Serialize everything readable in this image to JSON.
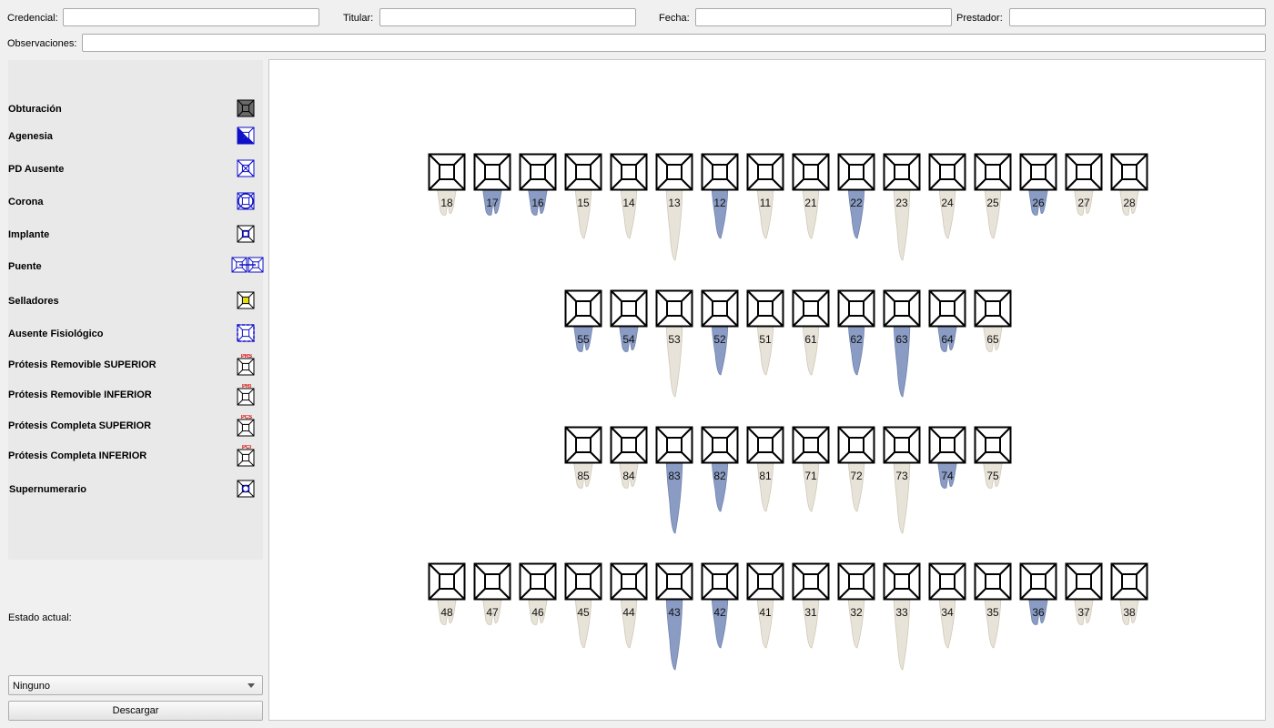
{
  "header": {
    "credencial_label": "Credencial:",
    "credencial_value": "",
    "titular_label": "Titular:",
    "titular_value": "",
    "fecha_label": "Fecha:",
    "fecha_value": "",
    "prestador_label": "Prestador:",
    "prestador_value": "",
    "observaciones_label": "Observaciones:",
    "observaciones_value": ""
  },
  "legend": [
    {
      "label": "Obturación",
      "icon": "obturacion-icon"
    },
    {
      "label": "Agenesia",
      "icon": "agenesia-icon"
    },
    {
      "label": "PD Ausente",
      "icon": "pd-ausente-icon"
    },
    {
      "label": "Corona",
      "icon": "corona-icon"
    },
    {
      "label": "Implante",
      "icon": "implante-icon"
    },
    {
      "label": "Puente",
      "icon": "puente-icon"
    },
    {
      "label": "Selladores",
      "icon": "selladores-icon"
    },
    {
      "label": "Ausente Fisiológico",
      "icon": "ausente-fisiologico-icon"
    },
    {
      "label": "Prótesis Removible SUPERIOR",
      "icon": "protesis-removible-superior-icon",
      "tag": "PRS"
    },
    {
      "label": "Prótesis Removible INFERIOR",
      "icon": "protesis-removible-inferior-icon",
      "tag": "PRI"
    },
    {
      "label": "Prótesis Completa SUPERIOR",
      "icon": "protesis-completa-superior-icon",
      "tag": "PCS"
    },
    {
      "label": "Prótesis Completa INFERIOR",
      "icon": "protesis-completa-inferior-icon",
      "tag": "PCI"
    },
    {
      "label": "Supernumerario",
      "icon": "supernumerario-icon"
    }
  ],
  "estado_actual_label": "Estado actual:",
  "estado_select": {
    "selected": "Ninguno"
  },
  "download_label": "Descargar",
  "colors": {
    "tooth_outline": "#000000",
    "root_ivory": "#e8e3d8",
    "root_blue": "#8a9cc4",
    "legend_blue": "#1010c8"
  },
  "odontogram": {
    "rows": [
      {
        "teeth": [
          "18",
          "17",
          "16",
          "15",
          "14",
          "13",
          "12",
          "11",
          "21",
          "22",
          "23",
          "24",
          "25",
          "26",
          "27",
          "28"
        ],
        "blue": [
          "17",
          "16",
          "12",
          "22",
          "26"
        ]
      },
      {
        "teeth": [
          "55",
          "54",
          "53",
          "52",
          "51",
          "61",
          "62",
          "63",
          "64",
          "65"
        ],
        "blue": [
          "55",
          "54",
          "52",
          "62",
          "63",
          "64"
        ]
      },
      {
        "teeth": [
          "85",
          "84",
          "83",
          "82",
          "81",
          "71",
          "72",
          "73",
          "74",
          "75"
        ],
        "blue": [
          "83",
          "82",
          "74"
        ]
      },
      {
        "teeth": [
          "48",
          "47",
          "46",
          "45",
          "44",
          "43",
          "42",
          "41",
          "31",
          "32",
          "33",
          "34",
          "35",
          "36",
          "37",
          "38"
        ],
        "blue": [
          "43",
          "42",
          "36"
        ]
      }
    ]
  }
}
